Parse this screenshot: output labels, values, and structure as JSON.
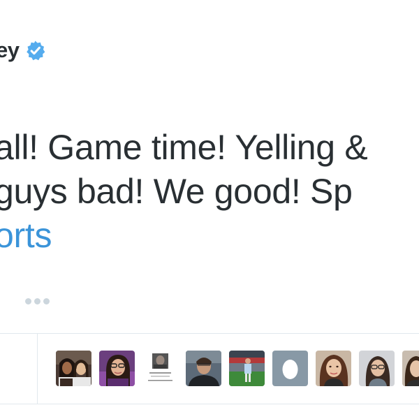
{
  "tweet": {
    "author_name_partial": "ey",
    "verified_icon": "verified-badge-icon",
    "lines": [
      "all! Game time! Yelling &",
      "guys bad! We good! Sp",
      "orts"
    ],
    "hashtag_color": "#3b94d9",
    "text_color": "#292f33"
  },
  "actions": {
    "more_icon": "more-dots-icon"
  },
  "likers": {
    "avatars": [
      {
        "name": "avatar-two-women"
      },
      {
        "name": "avatar-woman-glasses-purple"
      },
      {
        "name": "avatar-poster-thumbnail"
      },
      {
        "name": "avatar-man-dark"
      },
      {
        "name": "avatar-soccer-player"
      },
      {
        "name": "avatar-default-egg"
      },
      {
        "name": "avatar-woman-brown-hair"
      },
      {
        "name": "avatar-woman-glasses"
      },
      {
        "name": "avatar-partial"
      }
    ]
  },
  "colors": {
    "divider": "#e1e8ed",
    "verified_blue": "#55acee",
    "egg_bg": "#8899a6",
    "dots": "#ccd6dd"
  }
}
